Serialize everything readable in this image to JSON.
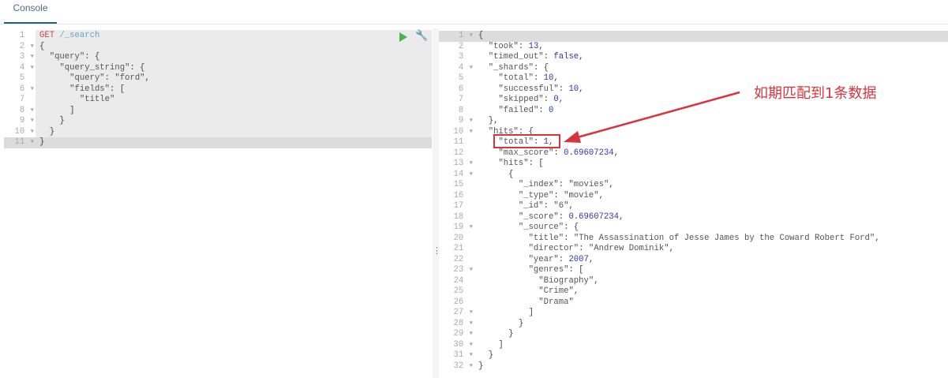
{
  "tabs": [
    {
      "label": "Console",
      "active": true
    }
  ],
  "request": {
    "lines": [
      [
        [
          "m",
          "GET"
        ],
        [
          "p",
          " "
        ],
        [
          "u",
          "/_search"
        ]
      ],
      [
        [
          "p",
          "{"
        ]
      ],
      [
        [
          "p",
          "  "
        ],
        [
          "k",
          "\"query\""
        ],
        [
          "p",
          ": {"
        ]
      ],
      [
        [
          "p",
          "    "
        ],
        [
          "k",
          "\"query_string\""
        ],
        [
          "p",
          ": {"
        ]
      ],
      [
        [
          "p",
          "      "
        ],
        [
          "k",
          "\"query\""
        ],
        [
          "p",
          ": "
        ],
        [
          "s",
          "\"ford\""
        ],
        [
          "p",
          ","
        ]
      ],
      [
        [
          "p",
          "      "
        ],
        [
          "k",
          "\"fields\""
        ],
        [
          "p",
          ": ["
        ]
      ],
      [
        [
          "p",
          "        "
        ],
        [
          "s",
          "\"title\""
        ]
      ],
      [
        [
          "p",
          "      ]"
        ]
      ],
      [
        [
          "p",
          "    }"
        ]
      ],
      [
        [
          "p",
          "  }"
        ]
      ],
      [
        [
          "p",
          "}"
        ]
      ]
    ],
    "fold_lines": [
      2,
      3,
      4,
      6,
      8,
      9,
      10,
      11
    ],
    "active_line": 11
  },
  "response": {
    "lines": [
      [
        [
          "p",
          "{"
        ]
      ],
      [
        [
          "p",
          "  "
        ],
        [
          "k",
          "\"took\""
        ],
        [
          "p",
          ": "
        ],
        [
          "n",
          "13"
        ],
        [
          "p",
          ","
        ]
      ],
      [
        [
          "p",
          "  "
        ],
        [
          "k",
          "\"timed_out\""
        ],
        [
          "p",
          ": "
        ],
        [
          "n",
          "false"
        ],
        [
          "p",
          ","
        ]
      ],
      [
        [
          "p",
          "  "
        ],
        [
          "k",
          "\"_shards\""
        ],
        [
          "p",
          ": {"
        ]
      ],
      [
        [
          "p",
          "    "
        ],
        [
          "k",
          "\"total\""
        ],
        [
          "p",
          ": "
        ],
        [
          "n",
          "10"
        ],
        [
          "p",
          ","
        ]
      ],
      [
        [
          "p",
          "    "
        ],
        [
          "k",
          "\"successful\""
        ],
        [
          "p",
          ": "
        ],
        [
          "n",
          "10"
        ],
        [
          "p",
          ","
        ]
      ],
      [
        [
          "p",
          "    "
        ],
        [
          "k",
          "\"skipped\""
        ],
        [
          "p",
          ": "
        ],
        [
          "n",
          "0"
        ],
        [
          "p",
          ","
        ]
      ],
      [
        [
          "p",
          "    "
        ],
        [
          "k",
          "\"failed\""
        ],
        [
          "p",
          ": "
        ],
        [
          "n",
          "0"
        ]
      ],
      [
        [
          "p",
          "  },"
        ]
      ],
      [
        [
          "p",
          "  "
        ],
        [
          "k",
          "\"hits\""
        ],
        [
          "p",
          ": {"
        ]
      ],
      [
        [
          "p",
          "    "
        ],
        [
          "k",
          "\"total\""
        ],
        [
          "p",
          ": "
        ],
        [
          "n",
          "1"
        ],
        [
          "p",
          ","
        ]
      ],
      [
        [
          "p",
          "    "
        ],
        [
          "k",
          "\"max_score\""
        ],
        [
          "p",
          ": "
        ],
        [
          "n",
          "0.69607234"
        ],
        [
          "p",
          ","
        ]
      ],
      [
        [
          "p",
          "    "
        ],
        [
          "k",
          "\"hits\""
        ],
        [
          "p",
          ": ["
        ]
      ],
      [
        [
          "p",
          "      {"
        ]
      ],
      [
        [
          "p",
          "        "
        ],
        [
          "k",
          "\"_index\""
        ],
        [
          "p",
          ": "
        ],
        [
          "s",
          "\"movies\""
        ],
        [
          "p",
          ","
        ]
      ],
      [
        [
          "p",
          "        "
        ],
        [
          "k",
          "\"_type\""
        ],
        [
          "p",
          ": "
        ],
        [
          "s",
          "\"movie\""
        ],
        [
          "p",
          ","
        ]
      ],
      [
        [
          "p",
          "        "
        ],
        [
          "k",
          "\"_id\""
        ],
        [
          "p",
          ": "
        ],
        [
          "s",
          "\"6\""
        ],
        [
          "p",
          ","
        ]
      ],
      [
        [
          "p",
          "        "
        ],
        [
          "k",
          "\"_score\""
        ],
        [
          "p",
          ": "
        ],
        [
          "n",
          "0.69607234"
        ],
        [
          "p",
          ","
        ]
      ],
      [
        [
          "p",
          "        "
        ],
        [
          "k",
          "\"_source\""
        ],
        [
          "p",
          ": {"
        ]
      ],
      [
        [
          "p",
          "          "
        ],
        [
          "k",
          "\"title\""
        ],
        [
          "p",
          ": "
        ],
        [
          "s",
          "\"The Assassination of Jesse James by the Coward Robert Ford\""
        ],
        [
          "p",
          ","
        ]
      ],
      [
        [
          "p",
          "          "
        ],
        [
          "k",
          "\"director\""
        ],
        [
          "p",
          ": "
        ],
        [
          "s",
          "\"Andrew Dominik\""
        ],
        [
          "p",
          ","
        ]
      ],
      [
        [
          "p",
          "          "
        ],
        [
          "k",
          "\"year\""
        ],
        [
          "p",
          ": "
        ],
        [
          "n",
          "2007"
        ],
        [
          "p",
          ","
        ]
      ],
      [
        [
          "p",
          "          "
        ],
        [
          "k",
          "\"genres\""
        ],
        [
          "p",
          ": ["
        ]
      ],
      [
        [
          "p",
          "            "
        ],
        [
          "s",
          "\"Biography\""
        ],
        [
          "p",
          ","
        ]
      ],
      [
        [
          "p",
          "            "
        ],
        [
          "s",
          "\"Crime\""
        ],
        [
          "p",
          ","
        ]
      ],
      [
        [
          "p",
          "            "
        ],
        [
          "s",
          "\"Drama\""
        ]
      ],
      [
        [
          "p",
          "          ]"
        ]
      ],
      [
        [
          "p",
          "        }"
        ]
      ],
      [
        [
          "p",
          "      }"
        ]
      ],
      [
        [
          "p",
          "    ]"
        ]
      ],
      [
        [
          "p",
          "  }"
        ]
      ],
      [
        [
          "p",
          "}"
        ]
      ]
    ],
    "fold_lines": [
      1,
      4,
      9,
      10,
      13,
      14,
      19,
      23,
      27,
      28,
      29,
      30,
      31,
      32
    ],
    "active_line": 1
  },
  "annotation": {
    "text": "如期匹配到1条数据",
    "color": "#d9343c"
  }
}
